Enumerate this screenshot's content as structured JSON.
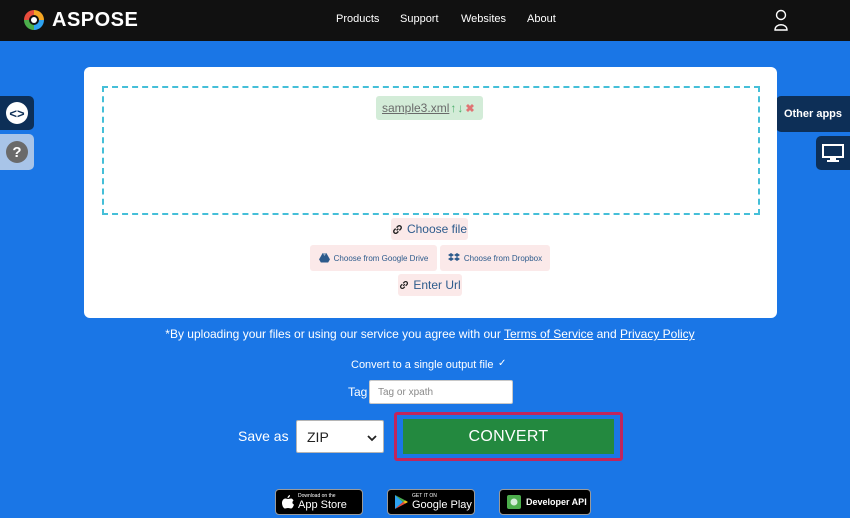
{
  "header": {
    "brand": "ASPOSE",
    "nav": [
      "Products",
      "Support",
      "Websites",
      "About"
    ],
    "user_icon": "user-icon"
  },
  "side": {
    "left_embed_icon": "code-icon",
    "left_help_icon": "question-icon",
    "left_embed_glyph": "<>",
    "left_help_glyph": "?",
    "other_apps": "Other apps",
    "monitor_icon": "monitor-icon"
  },
  "upload": {
    "file_name": "sample3.xml",
    "choose_file": "Choose file",
    "google_drive": "Choose from Google Drive",
    "dropbox": "Choose from Dropbox",
    "enter_url": "Enter Url"
  },
  "agreement": {
    "prefix": "*By uploading your files or using our service you agree with our ",
    "terms": "Terms of Service",
    "and": " and ",
    "privacy": "Privacy Policy"
  },
  "options": {
    "single_output": "Convert to a single output file",
    "single_output_checked": "✓",
    "tag_label": "Tag",
    "tag_placeholder": "Tag or xpath",
    "tag_value": ""
  },
  "convert": {
    "save_as": "Save as",
    "format": "ZIP",
    "button": "CONVERT"
  },
  "badges": {
    "appstore_small": "Download on the",
    "appstore_big": "App Store",
    "googleplay_small": "GET IT ON",
    "googleplay_big": "Google Play",
    "devapi": "Developer API"
  },
  "colors": {
    "background": "#1a76e6",
    "header": "#111111",
    "convert": "#23893f",
    "highlight": "#c0255d",
    "dropzone_border": "#45bfd8"
  }
}
